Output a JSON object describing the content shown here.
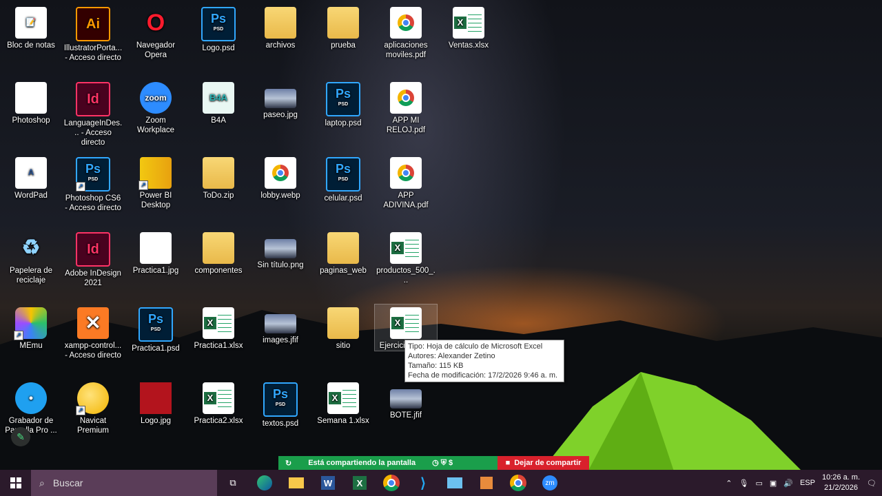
{
  "desktop": {
    "icons": [
      {
        "label": "Bloc de notas",
        "kind": "doc",
        "glyph": "📝"
      },
      {
        "label": "IllustratorPorta... - Acceso directo",
        "kind": "ai",
        "glyph": "Ai"
      },
      {
        "label": "Navegador Opera",
        "kind": "opera",
        "glyph": "O"
      },
      {
        "label": "Logo.psd",
        "kind": "ps",
        "glyph": "Ps"
      },
      {
        "label": "archivos",
        "kind": "folder",
        "glyph": ""
      },
      {
        "label": "prueba",
        "kind": "folder",
        "glyph": ""
      },
      {
        "label": "aplicaciones moviles.pdf",
        "kind": "pdf",
        "glyph": ""
      },
      {
        "label": "Ventas.xlsx",
        "kind": "excel",
        "glyph": ""
      },
      {
        "label": "Photoshop",
        "kind": "doc",
        "glyph": ""
      },
      {
        "label": "LanguageInDes... - Acceso directo",
        "kind": "id",
        "glyph": "Id"
      },
      {
        "label": "Zoom Workplace",
        "kind": "zoom",
        "glyph": "zoom"
      },
      {
        "label": "B4A",
        "kind": "b4a",
        "glyph": "B4A"
      },
      {
        "label": "paseo.jpg",
        "kind": "photo",
        "glyph": ""
      },
      {
        "label": "laptop.psd",
        "kind": "ps",
        "glyph": "Ps"
      },
      {
        "label": "APP MI RELOJ.pdf",
        "kind": "pdf",
        "glyph": ""
      },
      {
        "label": "WordPad",
        "kind": "doc",
        "glyph": "A"
      },
      {
        "label": "Photoshop CS6 - Acceso directo",
        "kind": "ps",
        "glyph": "Ps"
      },
      {
        "label": "Power BI Desktop",
        "kind": "powerbi",
        "glyph": ""
      },
      {
        "label": "ToDo.zip",
        "kind": "folder",
        "glyph": ""
      },
      {
        "label": "lobby.webp",
        "kind": "pdf",
        "glyph": ""
      },
      {
        "label": "celular.psd",
        "kind": "ps",
        "glyph": "Ps"
      },
      {
        "label": "APP ADIVINA.pdf",
        "kind": "pdf",
        "glyph": ""
      },
      {
        "label": "Papelera de reciclaje",
        "kind": "recycle",
        "glyph": "♻"
      },
      {
        "label": "Adobe InDesign 2021",
        "kind": "id",
        "glyph": "Id"
      },
      {
        "label": "Practica1.jpg",
        "kind": "doc",
        "glyph": ""
      },
      {
        "label": "componentes",
        "kind": "folder",
        "glyph": ""
      },
      {
        "label": "Sin título.png",
        "kind": "photo",
        "glyph": ""
      },
      {
        "label": "paginas_web",
        "kind": "folder",
        "glyph": ""
      },
      {
        "label": "productos_500_...",
        "kind": "excel",
        "glyph": ""
      },
      {
        "label": "MEmu",
        "kind": "memu",
        "glyph": ""
      },
      {
        "label": "xampp-control... - Acceso directo",
        "kind": "xampp",
        "glyph": "✕"
      },
      {
        "label": "Practica1.psd",
        "kind": "ps",
        "glyph": "Ps"
      },
      {
        "label": "Practica1.xlsx",
        "kind": "excel",
        "glyph": ""
      },
      {
        "label": "images.jfif",
        "kind": "photo",
        "glyph": ""
      },
      {
        "label": "sitio",
        "kind": "folder",
        "glyph": ""
      },
      {
        "label": "Ejercicio... SI...",
        "kind": "excel",
        "glyph": ""
      },
      {
        "label": "Grabador de Pantalla Pro ...",
        "kind": "camera",
        "glyph": "●"
      },
      {
        "label": "Navicat Premium",
        "kind": "navicat",
        "glyph": ""
      },
      {
        "label": "Logo.jpg",
        "kind": "red",
        "glyph": ""
      },
      {
        "label": "Practica2.xlsx",
        "kind": "excel",
        "glyph": ""
      },
      {
        "label": "textos.psd",
        "kind": "ps",
        "glyph": "Ps"
      },
      {
        "label": "Semana 1.xlsx",
        "kind": "excel",
        "glyph": ""
      },
      {
        "label": "BOTE.jfif",
        "kind": "photo",
        "glyph": ""
      }
    ]
  },
  "tooltip": {
    "line1": "Tipo: Hoja de cálculo de Microsoft Excel",
    "line2": "Autores: Alexander Zetino",
    "line3": "Tamaño: 115 KB",
    "line4": "Fecha de modificación: 17/2/2026 9:46 a. m."
  },
  "sharebar": {
    "status": "Está compartiendo la pantalla",
    "stop": "Dejar de compartir"
  },
  "taskbar": {
    "search_placeholder": "Buscar",
    "language": "ESP",
    "time": "10:26 a. m.",
    "date": "21/2/2026"
  },
  "colors": {
    "taskbar": "#2b1a2b",
    "share_green": "#1a9e4b",
    "share_red": "#d9212c"
  }
}
